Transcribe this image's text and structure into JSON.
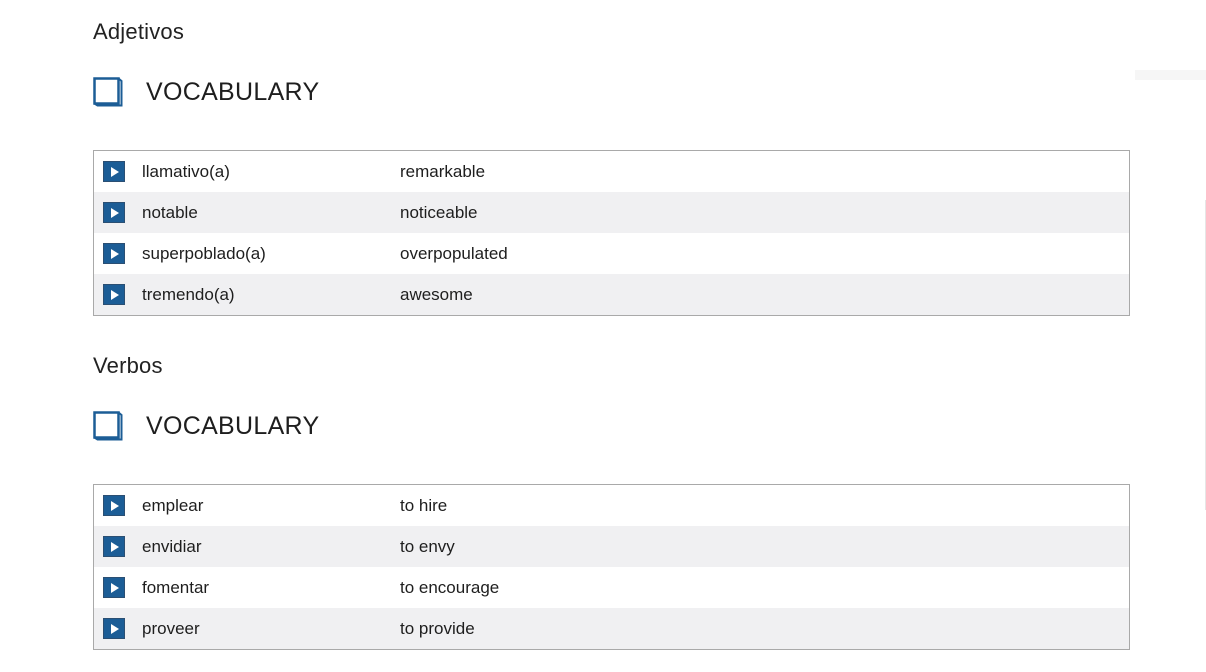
{
  "sections": [
    {
      "title": "Adjetivos",
      "vocab_label": "VOCABULARY",
      "items": [
        {
          "term": "llamativo(a)",
          "meaning": "remarkable"
        },
        {
          "term": "notable",
          "meaning": "noticeable"
        },
        {
          "term": "superpoblado(a)",
          "meaning": "overpopulated"
        },
        {
          "term": "tremendo(a)",
          "meaning": "awesome"
        }
      ]
    },
    {
      "title": "Verbos",
      "vocab_label": "VOCABULARY",
      "items": [
        {
          "term": "emplear",
          "meaning": "to hire"
        },
        {
          "term": "envidiar",
          "meaning": "to envy"
        },
        {
          "term": "fomentar",
          "meaning": "to encourage"
        },
        {
          "term": "proveer",
          "meaning": "to provide"
        }
      ]
    }
  ],
  "icons": {
    "book": "book-icon",
    "play": "play-icon"
  },
  "colors": {
    "accent": "#1c5d96",
    "row_alt": "#f0f0f2",
    "table_border": "#a9a9a9"
  }
}
